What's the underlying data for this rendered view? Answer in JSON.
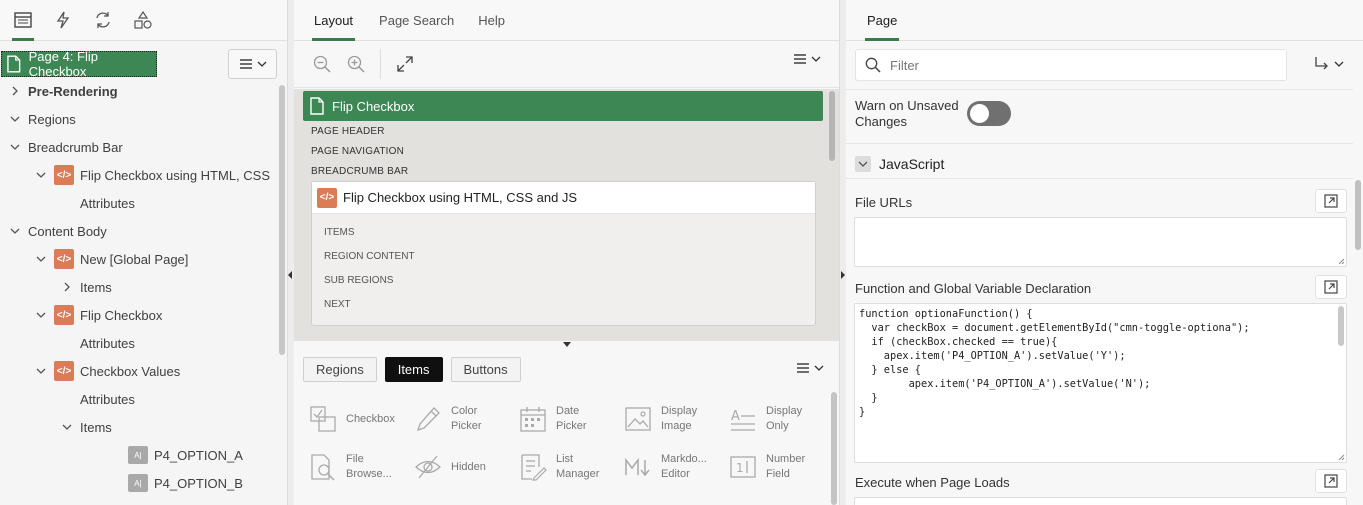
{
  "left": {
    "page_node_label": "Page 4: Flip Checkbox",
    "tree": [
      {
        "label": "Pre-Rendering",
        "level": 0,
        "twisty": "right",
        "bold": true
      },
      {
        "label": "Regions",
        "level": 0,
        "twisty": "down"
      },
      {
        "label": "Breadcrumb Bar",
        "level": 1,
        "twisty": "down"
      },
      {
        "label": "Flip Checkbox using HTML, CSS",
        "level": 2,
        "twisty": "down",
        "icon": "region"
      },
      {
        "label": "Attributes",
        "level": 3
      },
      {
        "label": "Content Body",
        "level": 1,
        "twisty": "down"
      },
      {
        "label": "New [Global Page]",
        "level": 2,
        "twisty": "down",
        "icon": "region"
      },
      {
        "label": "Items",
        "level": 3,
        "twisty": "right"
      },
      {
        "label": "Flip Checkbox",
        "level": 2,
        "twisty": "down",
        "icon": "region"
      },
      {
        "label": "Attributes",
        "level": 3
      },
      {
        "label": "Checkbox Values",
        "level": 2,
        "twisty": "down",
        "icon": "region"
      },
      {
        "label": "Attributes",
        "level": 3
      },
      {
        "label": "Items",
        "level": 3,
        "twisty": "down"
      },
      {
        "label": "P4_OPTION_A",
        "level": 4,
        "icon": "item"
      },
      {
        "label": "P4_OPTION_B",
        "level": 4,
        "icon": "item"
      }
    ]
  },
  "middle": {
    "tabs": [
      "Layout",
      "Page Search",
      "Help"
    ],
    "page_title": "Flip Checkbox",
    "slots": [
      "PAGE HEADER",
      "PAGE NAVIGATION",
      "BREADCRUMB BAR"
    ],
    "region_title": "Flip Checkbox using HTML, CSS and JS",
    "region_slots": [
      "ITEMS",
      "REGION CONTENT",
      "SUB REGIONS",
      "NEXT"
    ],
    "gallery_tabs": [
      "Regions",
      "Items",
      "Buttons"
    ],
    "gallery_items": [
      {
        "label1": "Checkbox",
        "label2": "",
        "icon": "checkbox-icon"
      },
      {
        "label1": "Color",
        "label2": "Picker",
        "icon": "color-picker-icon"
      },
      {
        "label1": "Date",
        "label2": "Picker",
        "icon": "date-picker-icon"
      },
      {
        "label1": "Display",
        "label2": "Image",
        "icon": "display-image-icon"
      },
      {
        "label1": "Display",
        "label2": "Only",
        "icon": "display-only-icon"
      },
      {
        "label1": "File",
        "label2": "Browse...",
        "icon": "file-browse-icon"
      },
      {
        "label1": "Hidden",
        "label2": "",
        "icon": "hidden-icon"
      },
      {
        "label1": "List",
        "label2": "Manager",
        "icon": "list-manager-icon"
      },
      {
        "label1": "Markdo...",
        "label2": "Editor",
        "icon": "markdown-icon"
      },
      {
        "label1": "Number",
        "label2": "Field",
        "icon": "number-field-icon"
      }
    ]
  },
  "right": {
    "tab": "Page",
    "filter_placeholder": "Filter",
    "warn_label": "Warn on Unsaved Changes",
    "warn_value": false,
    "section_title": "JavaScript",
    "file_urls_label": "File URLs",
    "function_label": "Function and Global Variable Declaration",
    "code": "function optionaFunction() {\n  var checkBox = document.getElementById(\"cmn-toggle-optiona\");\n  if (checkBox.checked == true){\n    apex.item('P4_OPTION_A').setValue('Y');\n  } else {\n        apex.item('P4_OPTION_A').setValue('N');\n  }\n}",
    "execute_label": "Execute when Page Loads"
  },
  "colors": {
    "accent_green": "#3d8755",
    "region_orange": "#d97c57"
  }
}
